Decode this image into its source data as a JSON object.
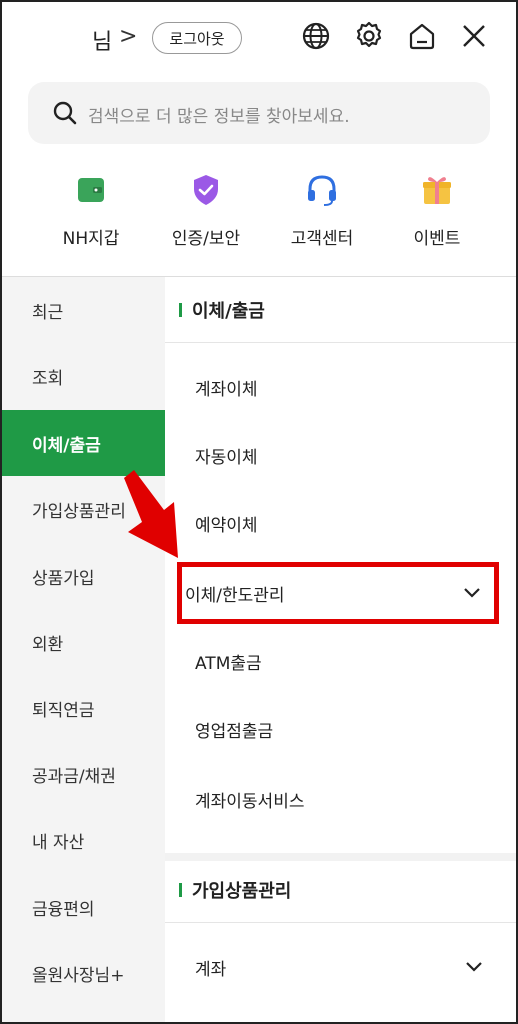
{
  "header": {
    "user_name": "님",
    "user_chevron": ">",
    "logout_label": "로그아웃",
    "icons": [
      "globe-icon",
      "settings-icon",
      "home-icon",
      "close-icon"
    ]
  },
  "search": {
    "placeholder": "검색으로 더 많은 정보를 찾아보세요."
  },
  "quick_menu": [
    {
      "label": "NH지갑",
      "icon": "wallet-icon",
      "color": "#3aa45a"
    },
    {
      "label": "인증/보안",
      "icon": "shield-check-icon",
      "color": "#9b59e6"
    },
    {
      "label": "고객센터",
      "icon": "headset-icon",
      "color": "#2f6fe0"
    },
    {
      "label": "이벤트",
      "icon": "gift-icon",
      "color": "#f0b429"
    }
  ],
  "left_nav": {
    "items": [
      "최근",
      "조회",
      "이체/출금",
      "가입상품관리",
      "상품가입",
      "외환",
      "퇴직연금",
      "공과금/채권",
      "내 자산",
      "금융편의",
      "올원사장님+"
    ],
    "active_index": 2
  },
  "content": {
    "section1_title": "이체/출금",
    "section1_items": [
      "계좌이체",
      "자동이체",
      "예약이체",
      "이체/한도관리",
      "ATM출금",
      "영업점출금",
      "계좌이동서비스"
    ],
    "section2_title": "가입상품관리",
    "section2_items": [
      "계좌"
    ]
  },
  "colors": {
    "accent": "#1f9a46",
    "highlight": "#e00000"
  }
}
